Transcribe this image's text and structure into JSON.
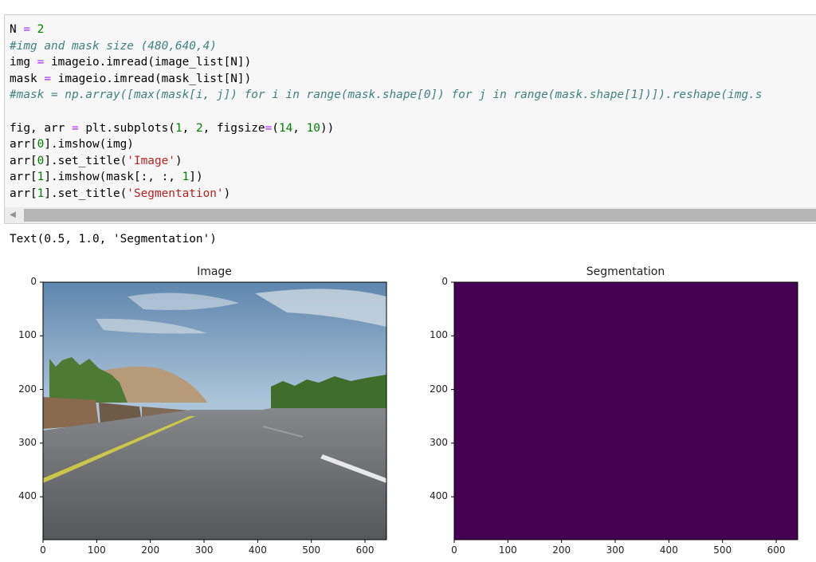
{
  "code_cell": {
    "lines": [
      [
        [
          "N ",
          ""
        ],
        [
          "=",
          "o"
        ],
        [
          " 2",
          "k"
        ]
      ],
      [
        [
          "#img and mask size (480,640,4)",
          "c"
        ]
      ],
      [
        [
          "img ",
          ""
        ],
        [
          "=",
          "o"
        ],
        [
          " imageio.imread(image_list[N])",
          ""
        ]
      ],
      [
        [
          "mask ",
          ""
        ],
        [
          "=",
          "o"
        ],
        [
          " imageio.imread(mask_list[N])",
          ""
        ]
      ],
      [
        [
          "#mask = np.array([max(mask[i, j]) for i in range(mask.shape[0]) for j in range(mask.shape[1])]).reshape(img.s",
          "c"
        ]
      ],
      [
        [
          "",
          ""
        ]
      ],
      [
        [
          "fig, arr ",
          ""
        ],
        [
          "=",
          "o"
        ],
        [
          " plt.subplots(",
          ""
        ],
        [
          "1",
          "k"
        ],
        [
          ", ",
          ""
        ],
        [
          "2",
          "k"
        ],
        [
          ", figsize",
          ""
        ],
        [
          "=",
          "o"
        ],
        [
          "(",
          ""
        ],
        [
          "14",
          "k"
        ],
        [
          ", ",
          ""
        ],
        [
          "10",
          "k"
        ],
        [
          "))",
          ""
        ]
      ],
      [
        [
          "arr[",
          ""
        ],
        [
          "0",
          "k"
        ],
        [
          "].imshow(img)",
          ""
        ]
      ],
      [
        [
          "arr[",
          ""
        ],
        [
          "0",
          "k"
        ],
        [
          "].set_title(",
          ""
        ],
        [
          "'Image'",
          "s"
        ],
        [
          ")",
          ""
        ]
      ],
      [
        [
          "arr[",
          ""
        ],
        [
          "1",
          "k"
        ],
        [
          "].imshow(mask[:, :, ",
          ""
        ],
        [
          "1",
          "k"
        ],
        [
          "])",
          ""
        ]
      ],
      [
        [
          "arr[",
          ""
        ],
        [
          "1",
          "k"
        ],
        [
          "].set_title(",
          ""
        ],
        [
          "'Segmentation'",
          "s"
        ],
        [
          ")",
          ""
        ]
      ]
    ]
  },
  "output": {
    "text": "Text(0.5, 1.0, 'Segmentation')"
  },
  "figure": {
    "plots": [
      {
        "title": "Image",
        "x_ticks": [
          "0",
          "100",
          "200",
          "300",
          "400",
          "500",
          "600"
        ],
        "y_ticks": [
          "0",
          "100",
          "200",
          "300",
          "400"
        ]
      },
      {
        "title": "Segmentation",
        "x_ticks": [
          "0",
          "100",
          "200",
          "300",
          "400",
          "500",
          "600"
        ],
        "y_ticks": [
          "0",
          "100",
          "200",
          "300",
          "400"
        ],
        "fill_color": "#440154"
      }
    ]
  },
  "icons": {
    "scroll_left": "chevron-left-icon"
  }
}
